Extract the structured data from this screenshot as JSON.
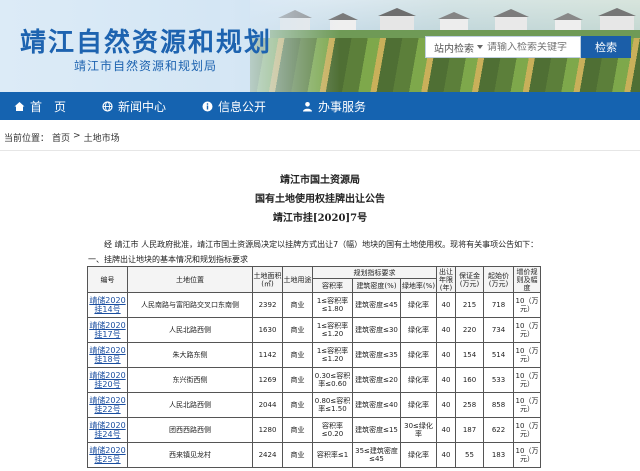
{
  "site": {
    "title": "靖江自然资源和规划",
    "subtitle": "靖江市自然资源和规划局"
  },
  "search": {
    "scope_label": "站内检索",
    "placeholder": "请输入检索关键字",
    "button_label": "检索"
  },
  "nav": [
    {
      "label": "首　页",
      "icon": "home-icon"
    },
    {
      "label": "新闻中心",
      "icon": "globe-icon"
    },
    {
      "label": "信息公开",
      "icon": "info-icon"
    },
    {
      "label": "办事服务",
      "icon": "user-icon"
    }
  ],
  "breadcrumb": {
    "prefix": "当前位置：",
    "items": [
      "首页",
      ">",
      "土地市场"
    ]
  },
  "article": {
    "org": "靖江市国土资源局",
    "title": "国有土地使用权挂牌出让公告",
    "number": "靖江市挂[2020]7号",
    "intro": "经 靖江市 人民政府批准，靖江市国土资源局决定以挂牌方式出让7（幅）地块的国有土地使用权。现将有关事项公告如下：",
    "section1": "一、挂牌出让地块的基本情况和规划指标要求"
  },
  "table": {
    "headers": {
      "code": "编号",
      "location": "土地位置",
      "area": "土地面积(㎡)",
      "use": "土地用途",
      "planning": "规划指标要求",
      "far": "容积率",
      "density": "建筑密度(%)",
      "green": "绿地率(%)",
      "term": "出让年限(年)",
      "deposit": "保证金(万元)",
      "start_price": "起始价(万元)",
      "increment": "增价规则及幅度"
    },
    "rows": [
      {
        "code": "靖储2020挂14号",
        "location": "人民南路与富阳路交叉口东南侧",
        "area": "2392",
        "use": "商业",
        "far": "1≤容积率≤1.80",
        "density": "建筑密度≤45",
        "green": "绿化率",
        "term": "40",
        "deposit": "215",
        "start_price": "718",
        "increment": "10（万元）"
      },
      {
        "code": "靖储2020挂17号",
        "location": "人民北路西侧",
        "area": "1630",
        "use": "商业",
        "far": "1≤容积率≤1.20",
        "density": "建筑密度≤30",
        "green": "绿化率",
        "term": "40",
        "deposit": "220",
        "start_price": "734",
        "increment": "10（万元）"
      },
      {
        "code": "靖储2020挂18号",
        "location": "朱大路东侧",
        "area": "1142",
        "use": "商业",
        "far": "1≤容积率≤1.20",
        "density": "建筑密度≤35",
        "green": "绿化率",
        "term": "40",
        "deposit": "154",
        "start_price": "514",
        "increment": "10（万元）"
      },
      {
        "code": "靖储2020挂20号",
        "location": "东兴街西侧",
        "area": "1269",
        "use": "商业",
        "far": "0.30≤容积率≤0.60",
        "density": "建筑密度≤20",
        "green": "绿化率",
        "term": "40",
        "deposit": "160",
        "start_price": "533",
        "increment": "10（万元）"
      },
      {
        "code": "靖储2020挂22号",
        "location": "人民北路西侧",
        "area": "2044",
        "use": "商业",
        "far": "0.80≤容积率≤1.50",
        "density": "建筑密度≤40",
        "green": "绿化率",
        "term": "40",
        "deposit": "258",
        "start_price": "858",
        "increment": "10（万元）"
      },
      {
        "code": "靖储2020挂24号",
        "location": "团西西路西侧",
        "area": "1280",
        "use": "商业",
        "far": "容积率≤0.20",
        "density": "建筑密度≤15",
        "green": "30≤绿化率",
        "term": "40",
        "deposit": "187",
        "start_price": "622",
        "increment": "10（万元）"
      },
      {
        "code": "靖储2020挂25号",
        "location": "西来镇见龙村",
        "area": "2424",
        "use": "商业",
        "far": "容积率≤1",
        "density": "35≤建筑密度≤45",
        "green": "绿化率",
        "term": "40",
        "deposit": "55",
        "start_price": "183",
        "increment": "10（万元）"
      }
    ]
  },
  "colors": {
    "brand_blue": "#1563b0",
    "title_blue": "#1d63b0",
    "link_blue": "#1a4ea0"
  }
}
